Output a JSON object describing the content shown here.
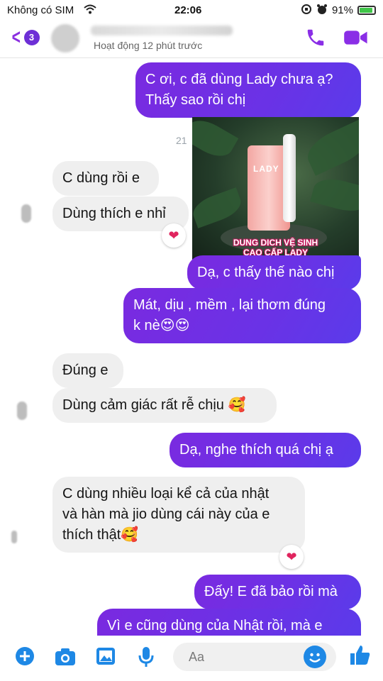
{
  "status_bar": {
    "carrier": "Không có SIM",
    "time": "22:06",
    "battery": "91%",
    "battery_level": 0.91
  },
  "header": {
    "back_badge": "3",
    "contact_status": "Hoạt động 12 phút trước"
  },
  "messages": [
    {
      "dir": "out",
      "text": "C ơi, c đã dùng Lady chưa ạ?\nThấy sao rồi chị"
    },
    {
      "dir": "timestamp",
      "text": "21"
    },
    {
      "dir": "in",
      "text": "C dùng rồi e"
    },
    {
      "dir": "in",
      "text": "Dùng thích e nhỉ"
    },
    {
      "dir": "image",
      "caption_line1": "DUNG DICH VỆ SINH",
      "caption_line2": "CAO CẤP LADY",
      "bottle_label": "LADY"
    },
    {
      "dir": "out",
      "text": "Dạ, c thấy thế nào chị"
    },
    {
      "dir": "out",
      "text": "Mát, dịu , mềm , lại thơm đúng\nk nè😍😍"
    },
    {
      "dir": "in",
      "text": "Đúng e"
    },
    {
      "dir": "in",
      "text": "Dùng cảm giác rất rễ chịu 🥰"
    },
    {
      "dir": "out",
      "text": "Dạ, nghe thích quá chị ạ"
    },
    {
      "dir": "in",
      "text": "C dùng nhiều loại kể cả của nhật\nvà hàn mà jio dùng cái này của e\nthích thật🥰"
    },
    {
      "dir": "out",
      "text": "Đấy! E đã bảo rồi mà"
    },
    {
      "dir": "out",
      "text": "Vì e cũng dùng của Nhật rồi, mà e"
    }
  ],
  "reactions": {
    "heart": "❤"
  },
  "composer": {
    "placeholder": "Aa"
  },
  "colors": {
    "accent": "#7b2ff7",
    "outgoing_bubble": "#6a32e6",
    "incoming_bubble": "#efefef",
    "badge": "#6d2fd6"
  },
  "icons": [
    "back-chevron-icon",
    "phone-icon",
    "video-camera-icon",
    "plus-icon",
    "camera-icon",
    "image-icon",
    "microphone-icon",
    "emoji-icon",
    "thumbs-up-icon"
  ]
}
